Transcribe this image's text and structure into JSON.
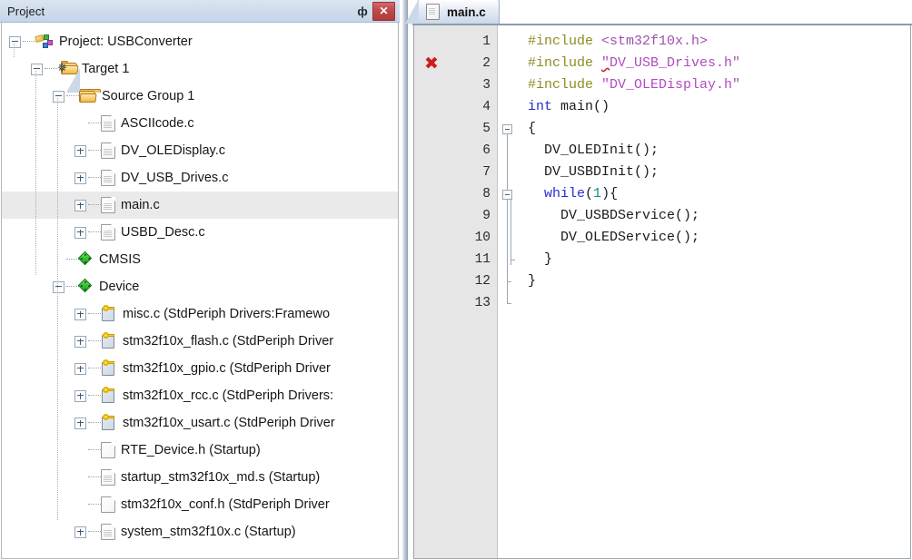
{
  "project_pane": {
    "title": "Project",
    "pin_icon": "pin-icon",
    "pin_glyph": "ф",
    "close_label": "✕",
    "tree": [
      {
        "depth": 0,
        "label": "Project: USBConverter",
        "icon": "project-icon",
        "expander": "minus",
        "selected": false
      },
      {
        "depth": 1,
        "label": "Target 1",
        "icon": "target-folder-icon",
        "expander": "minus",
        "selected": false
      },
      {
        "depth": 2,
        "label": "Source Group 1",
        "icon": "folder-icon",
        "expander": "minus",
        "selected": false
      },
      {
        "depth": 3,
        "label": "ASCIIcode.c",
        "icon": "c-file-icon",
        "expander": "none",
        "selected": false
      },
      {
        "depth": 3,
        "label": "DV_OLEDisplay.c",
        "icon": "c-file-icon",
        "expander": "plus",
        "selected": false
      },
      {
        "depth": 3,
        "label": "DV_USB_Drives.c",
        "icon": "c-file-icon",
        "expander": "plus",
        "selected": false
      },
      {
        "depth": 3,
        "label": "main.c",
        "icon": "c-file-icon",
        "expander": "plus",
        "selected": true
      },
      {
        "depth": 3,
        "label": "USBD_Desc.c",
        "icon": "c-file-icon",
        "expander": "plus",
        "selected": false
      },
      {
        "depth": 2,
        "label": "CMSIS",
        "icon": "component-diamond-icon",
        "expander": "none",
        "selected": false
      },
      {
        "depth": 2,
        "label": "Device",
        "icon": "component-diamond-icon",
        "expander": "minus",
        "selected": false
      },
      {
        "depth": 3,
        "label": "misc.c (StdPeriph Drivers:Framewo",
        "icon": "key-file-icon",
        "expander": "plus",
        "selected": false
      },
      {
        "depth": 3,
        "label": "stm32f10x_flash.c (StdPeriph Driver",
        "icon": "key-file-icon",
        "expander": "plus",
        "selected": false
      },
      {
        "depth": 3,
        "label": "stm32f10x_gpio.c (StdPeriph Driver",
        "icon": "key-file-icon",
        "expander": "plus",
        "selected": false
      },
      {
        "depth": 3,
        "label": "stm32f10x_rcc.c (StdPeriph Drivers:",
        "icon": "key-file-icon",
        "expander": "plus",
        "selected": false
      },
      {
        "depth": 3,
        "label": "stm32f10x_usart.c (StdPeriph Driver",
        "icon": "key-file-icon",
        "expander": "plus",
        "selected": false
      },
      {
        "depth": 3,
        "label": "RTE_Device.h (Startup)",
        "icon": "h-file-icon",
        "expander": "none",
        "selected": false
      },
      {
        "depth": 3,
        "label": "startup_stm32f10x_md.s (Startup)",
        "icon": "s-file-icon",
        "expander": "none",
        "selected": false
      },
      {
        "depth": 3,
        "label": "stm32f10x_conf.h (StdPeriph Driver",
        "icon": "h-file-icon",
        "expander": "none",
        "selected": false
      },
      {
        "depth": 3,
        "label": "system_stm32f10x.c (Startup)",
        "icon": "c-file-icon",
        "expander": "plus",
        "selected": false
      }
    ]
  },
  "editor": {
    "tabs": [
      {
        "label": "main.c",
        "icon": "c-file-icon",
        "active": true
      }
    ],
    "error_marker_line": 2,
    "error_marker_glyph": "✖",
    "line_numbers": [
      "1",
      "2",
      "3",
      "4",
      "5",
      "6",
      "7",
      "8",
      "9",
      "10",
      "11",
      "12",
      "13"
    ],
    "lines": [
      {
        "n": "1",
        "segments": [
          {
            "t": "#include ",
            "c": "pre"
          },
          {
            "t": "<stm32f10x.h>",
            "c": "inc"
          }
        ]
      },
      {
        "n": "2",
        "segments": [
          {
            "t": "#include ",
            "c": "pre"
          },
          {
            "t": "\"",
            "c": "str-squiggle"
          },
          {
            "t": "DV_USB_Drives.h\"",
            "c": "str"
          }
        ]
      },
      {
        "n": "3",
        "segments": [
          {
            "t": "#include ",
            "c": "pre"
          },
          {
            "t": "\"DV_OLEDisplay.h\"",
            "c": "str"
          }
        ]
      },
      {
        "n": "4",
        "segments": [
          {
            "t": "int",
            "c": "kw"
          },
          {
            "t": " main()",
            "c": "plain"
          }
        ]
      },
      {
        "n": "5",
        "segments": [
          {
            "t": "{",
            "c": "plain"
          }
        ]
      },
      {
        "n": "6",
        "segments": [
          {
            "t": "  DV_OLEDInit();",
            "c": "plain"
          }
        ]
      },
      {
        "n": "7",
        "segments": [
          {
            "t": "  DV_USBDInit();",
            "c": "plain"
          }
        ]
      },
      {
        "n": "8",
        "segments": [
          {
            "t": "  ",
            "c": "plain"
          },
          {
            "t": "while",
            "c": "kw"
          },
          {
            "t": "(",
            "c": "plain"
          },
          {
            "t": "1",
            "c": "num"
          },
          {
            "t": "){",
            "c": "plain"
          }
        ]
      },
      {
        "n": "9",
        "segments": [
          {
            "t": "    DV_USBDService();",
            "c": "plain"
          }
        ]
      },
      {
        "n": "10",
        "segments": [
          {
            "t": "    DV_OLEDService();",
            "c": "plain"
          }
        ]
      },
      {
        "n": "11",
        "segments": [
          {
            "t": "  }",
            "c": "plain"
          }
        ]
      },
      {
        "n": "12",
        "segments": [
          {
            "t": "}",
            "c": "plain"
          }
        ]
      },
      {
        "n": "13",
        "segments": [
          {
            "t": "",
            "c": "plain"
          }
        ]
      }
    ],
    "fold_markers": [
      {
        "line": 5,
        "type": "minus"
      },
      {
        "line": 8,
        "type": "minus"
      }
    ]
  },
  "colors": {
    "titlebar_gradient_top": "#dbe5f1",
    "titlebar_gradient_bottom": "#c5d4e8",
    "close_button": "#c04848",
    "selection": "#eaeaea",
    "gutter": "#e6e6e6",
    "preprocessor": "#8d8d22",
    "string": "#b14bbf",
    "keyword": "#2b2bd4",
    "number": "#0f8c8c",
    "error": "#d11a1a"
  }
}
